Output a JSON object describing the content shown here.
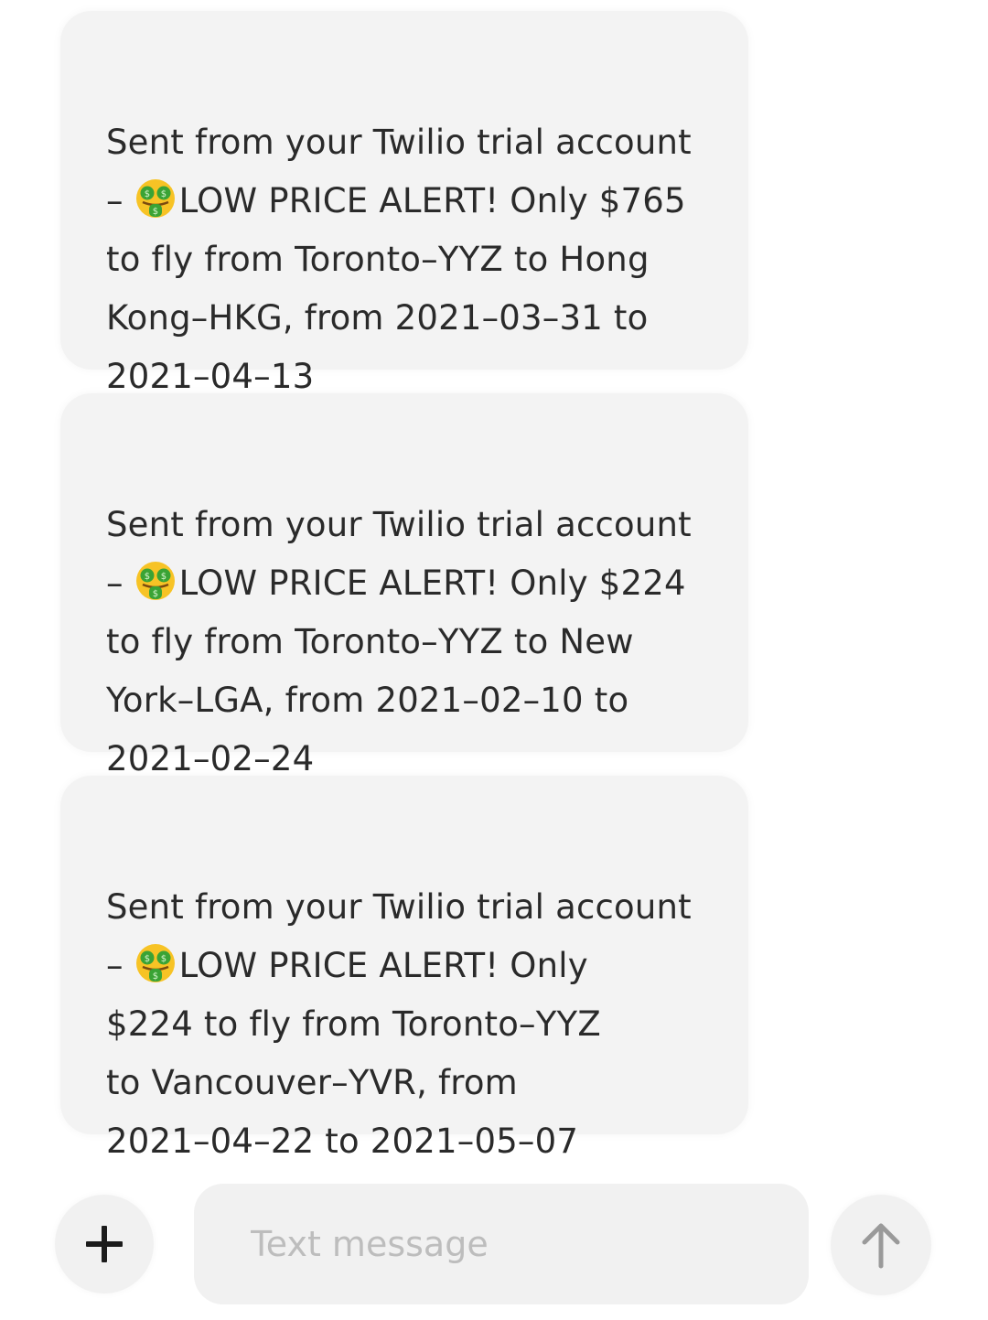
{
  "messages": [
    {
      "prefix": "Sent from your Twilio trial account\n– ",
      "emoji": "money-mouth-face-icon",
      "body": "LOW PRICE ALERT! Only $765\nto fly from Toronto–YYZ to Hong\nKong–HKG, from 2021–03–31 to\n2021–04–13"
    },
    {
      "prefix": "Sent from your Twilio trial account\n– ",
      "emoji": "money-mouth-face-icon",
      "body": "LOW PRICE ALERT! Only $224\nto fly from Toronto–YYZ to New\nYork–LGA, from 2021–02–10 to\n2021–02–24"
    },
    {
      "prefix": "Sent from your Twilio trial account\n– ",
      "emoji": "money-mouth-face-icon",
      "body": "LOW PRICE ALERT! Only\n$224 to fly from Toronto–YYZ\nto Vancouver–YVR, from\n2021–04–22 to 2021–05–07"
    }
  ],
  "composer": {
    "placeholder": "Text message",
    "add_icon": "plus-icon",
    "send_icon": "arrow-up-icon"
  },
  "colors": {
    "bubble": "#f3f3f3",
    "text": "#2a2a2a",
    "placeholder": "#bdbdbd",
    "emoji_face": "#f7c325",
    "emoji_accent": "#3aa335"
  }
}
